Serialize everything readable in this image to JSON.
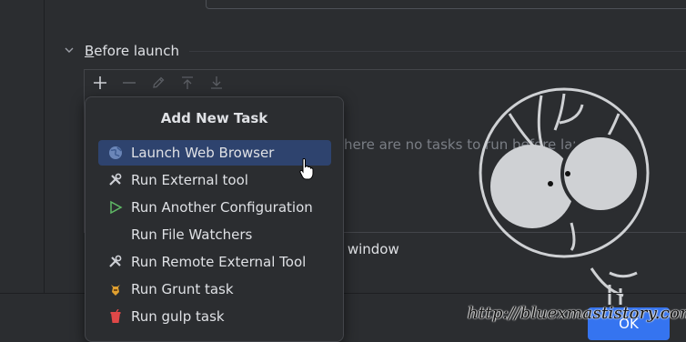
{
  "section": {
    "title_underlined": "B",
    "title_rest": "efore launch"
  },
  "toolbar": {
    "add": "add-icon",
    "remove": "minus-icon",
    "edit": "pencil-icon",
    "move_up": "move-up-icon",
    "move_down": "move-down-icon"
  },
  "tasks": {
    "empty_text": "here are no tasks to run before launch"
  },
  "background": {
    "window_text": "window"
  },
  "popup": {
    "title": "Add New Task",
    "items": [
      {
        "label": "Launch Web Browser",
        "icon": "globe-icon",
        "selected": true
      },
      {
        "label": "Run External tool",
        "icon": "tools-icon"
      },
      {
        "label": "Run Another Configuration",
        "icon": "run-icon"
      },
      {
        "label": "Run File Watchers",
        "icon": ""
      },
      {
        "label": "Run Remote External Tool",
        "icon": "tools-icon"
      },
      {
        "label": "Run Grunt task",
        "icon": "grunt-icon"
      },
      {
        "label": "Run gulp task",
        "icon": "gulp-icon"
      }
    ]
  },
  "buttons": {
    "ok": "OK"
  },
  "watermark": {
    "text": "http://bluexmastistory.com/"
  },
  "colors": {
    "accent": "#3574f0",
    "selection": "#2e436e",
    "background": "#2b2d30",
    "run_green": "#5fb865"
  }
}
